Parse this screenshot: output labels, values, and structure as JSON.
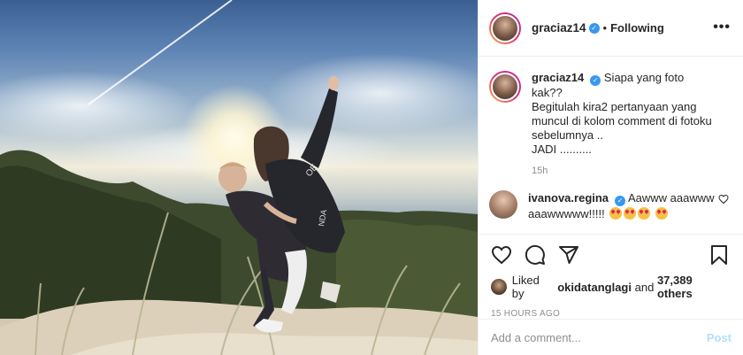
{
  "post": {
    "author": "graciaz14",
    "verified": true,
    "follow_status": "Following",
    "separator": "•",
    "more": "•••"
  },
  "caption": {
    "username": "graciaz14",
    "text": "Siapa yang foto kak??\nBegitulah kira2 pertanyaan yang muncul di kolom comment di fotoku sebelumnya ..\nJADI ..........",
    "age": "15h"
  },
  "comment": {
    "username": "ivanova.regina",
    "text": "Aawww aaawww aaawwwww!!!!!"
  },
  "likes": {
    "liked_by_prefix": "Liked by",
    "liked_by_user": "okidatanglagi",
    "and": "and",
    "count": "37,389 others"
  },
  "timestamp": "15 HOURS AGO",
  "add_comment": {
    "placeholder": "Add a comment...",
    "post_label": "Post"
  },
  "colors": {
    "verified_blue": "#3897f0",
    "post_disabled": "#b2dffc",
    "muted": "#8e8e8e"
  },
  "icons": [
    "heart-icon",
    "comment-icon",
    "share-icon",
    "bookmark-icon",
    "verified-badge-icon",
    "small-heart-icon"
  ]
}
